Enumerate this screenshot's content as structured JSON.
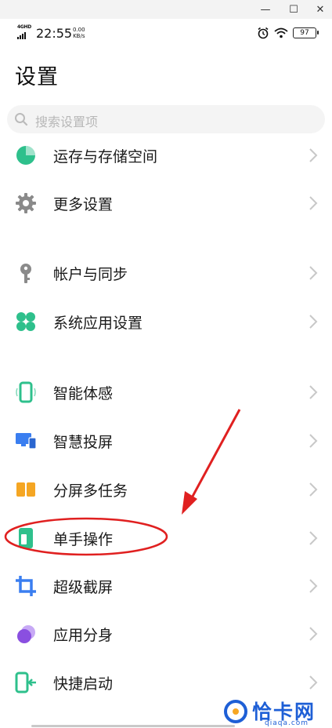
{
  "window": {
    "minimize_glyph": "—",
    "maximize_glyph": "☐",
    "close_glyph": "✕"
  },
  "status_bar": {
    "network": "4GHD",
    "time": "22:55",
    "speed_value": "0.00",
    "speed_unit": "KB/s",
    "battery": "97"
  },
  "page": {
    "title": "设置"
  },
  "search": {
    "placeholder": "搜索设置项"
  },
  "settings_items": [
    {
      "label": "运存与存储空间",
      "icon": "pie-chart-icon",
      "color": "#2ec08c"
    },
    {
      "label": "更多设置",
      "icon": "gear-icon",
      "color": "#8a8a8a"
    },
    {
      "label": "帐户与同步",
      "icon": "key-icon",
      "color": "#8a8a8a"
    },
    {
      "label": "系统应用设置",
      "icon": "four-leaf-icon",
      "color": "#2ec08c"
    },
    {
      "label": "智能体感",
      "icon": "phone-motion-icon",
      "color": "#2ec08c"
    },
    {
      "label": "智慧投屏",
      "icon": "screen-cast-icon",
      "color": "#3a7ef0"
    },
    {
      "label": "分屏多任务",
      "icon": "split-screen-icon",
      "color": "#f5a623"
    },
    {
      "label": "单手操作",
      "icon": "one-hand-icon",
      "color": "#2ec08c"
    },
    {
      "label": "超级截屏",
      "icon": "crop-icon",
      "color": "#3a7ef0"
    },
    {
      "label": "应用分身",
      "icon": "app-clone-icon",
      "color": "#8a4fe0"
    },
    {
      "label": "快捷启动",
      "icon": "quick-launch-icon",
      "color": "#2ec08c"
    }
  ],
  "annotation": {
    "highlight_color": "#e02020",
    "highlighted_item": "单手操作"
  },
  "watermark": {
    "text": "恰卡网",
    "subtext": "qiaqa.com"
  }
}
